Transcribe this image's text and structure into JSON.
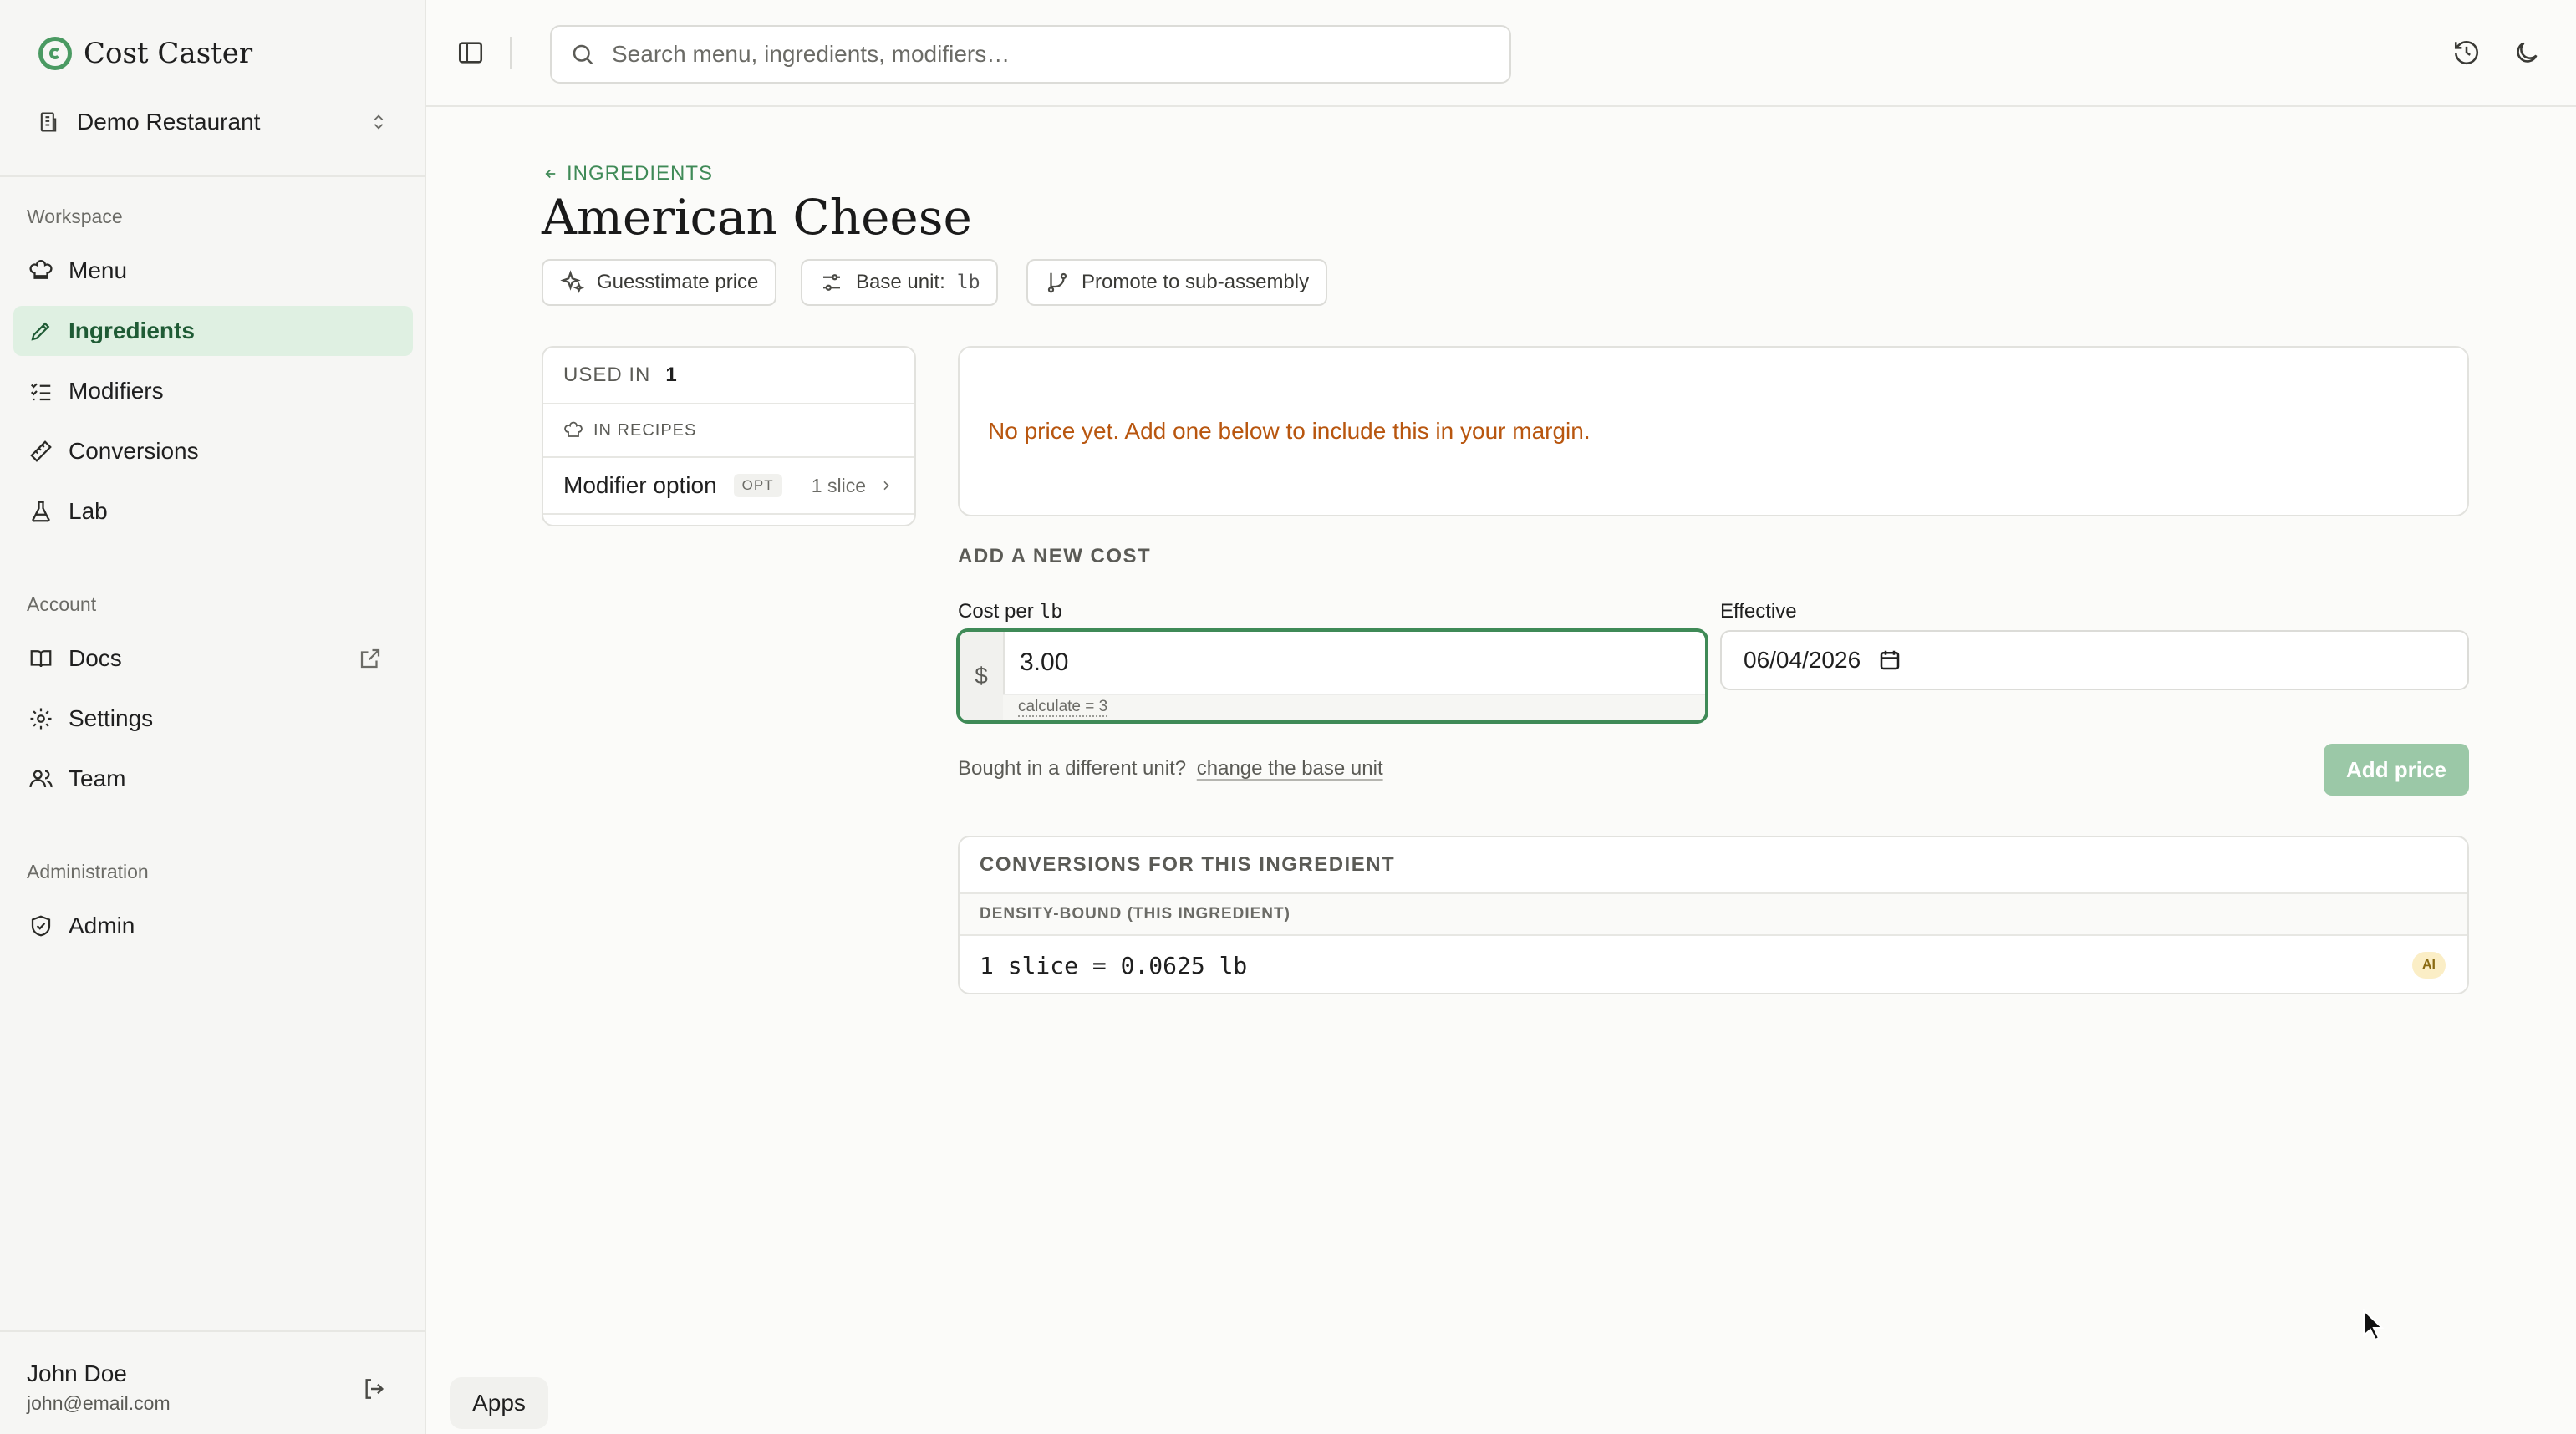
{
  "app": {
    "brand_name": "Cost Caster",
    "workspace_name": "Demo Restaurant"
  },
  "sidebar": {
    "workspace_label": "Workspace",
    "workspace_items": [
      {
        "label": "Menu",
        "icon": "chef-hat-icon",
        "active": false
      },
      {
        "label": "Ingredients",
        "icon": "pencil-icon",
        "active": true
      },
      {
        "label": "Modifiers",
        "icon": "list-checks-icon",
        "active": false
      },
      {
        "label": "Conversions",
        "icon": "ruler-icon",
        "active": false
      },
      {
        "label": "Lab",
        "icon": "flask-icon",
        "active": false
      }
    ],
    "account_label": "Account",
    "account_items": [
      {
        "label": "Docs",
        "icon": "book-icon"
      },
      {
        "label": "Settings",
        "icon": "gear-icon"
      },
      {
        "label": "Team",
        "icon": "users-icon"
      }
    ],
    "admin_label": "Administration",
    "admin_items": [
      {
        "label": "Admin",
        "icon": "shield-check-icon"
      }
    ],
    "user": {
      "name": "John Doe",
      "email": "john@email.com"
    }
  },
  "topbar": {
    "search_placeholder": "Search menu, ingredients, modifiers…"
  },
  "page": {
    "back_label": "INGREDIENTS",
    "title": "American Cheese",
    "chips": {
      "guesstimate": "Guesstimate price",
      "base_unit_label": "Base unit:",
      "base_unit_value": "lb",
      "promote": "Promote to sub-assembly"
    }
  },
  "used_in": {
    "label": "USED IN",
    "count": "1",
    "section": "IN RECIPES",
    "row_name": "Modifier option",
    "row_badge": "OPT",
    "row_qty": "1 slice"
  },
  "notice": {
    "text": "No price yet. Add one below to include this in your margin."
  },
  "add_cost": {
    "title": "ADD A NEW COST",
    "cost_label": "Cost per",
    "cost_unit": "lb",
    "currency": "$",
    "cost_value": "3.00",
    "calc_hint": "calculate = 3",
    "effective_label": "Effective",
    "effective_value": "06/04/2026",
    "bought_text": "Bought in a different unit?",
    "change_link": "change the base unit",
    "add_button": "Add price"
  },
  "conversions": {
    "title": "CONVERSIONS FOR THIS INGREDIENT",
    "subtitle": "DENSITY-BOUND (THIS INGREDIENT)",
    "row": "1 slice = 0.0625 lb",
    "badge": "AI"
  },
  "apps_label": "Apps",
  "colors": {
    "accent": "#3f8a57",
    "active_bg": "#dff0e2",
    "warning_text": "#b8560f",
    "button_disabled": "#9bc8a7"
  }
}
